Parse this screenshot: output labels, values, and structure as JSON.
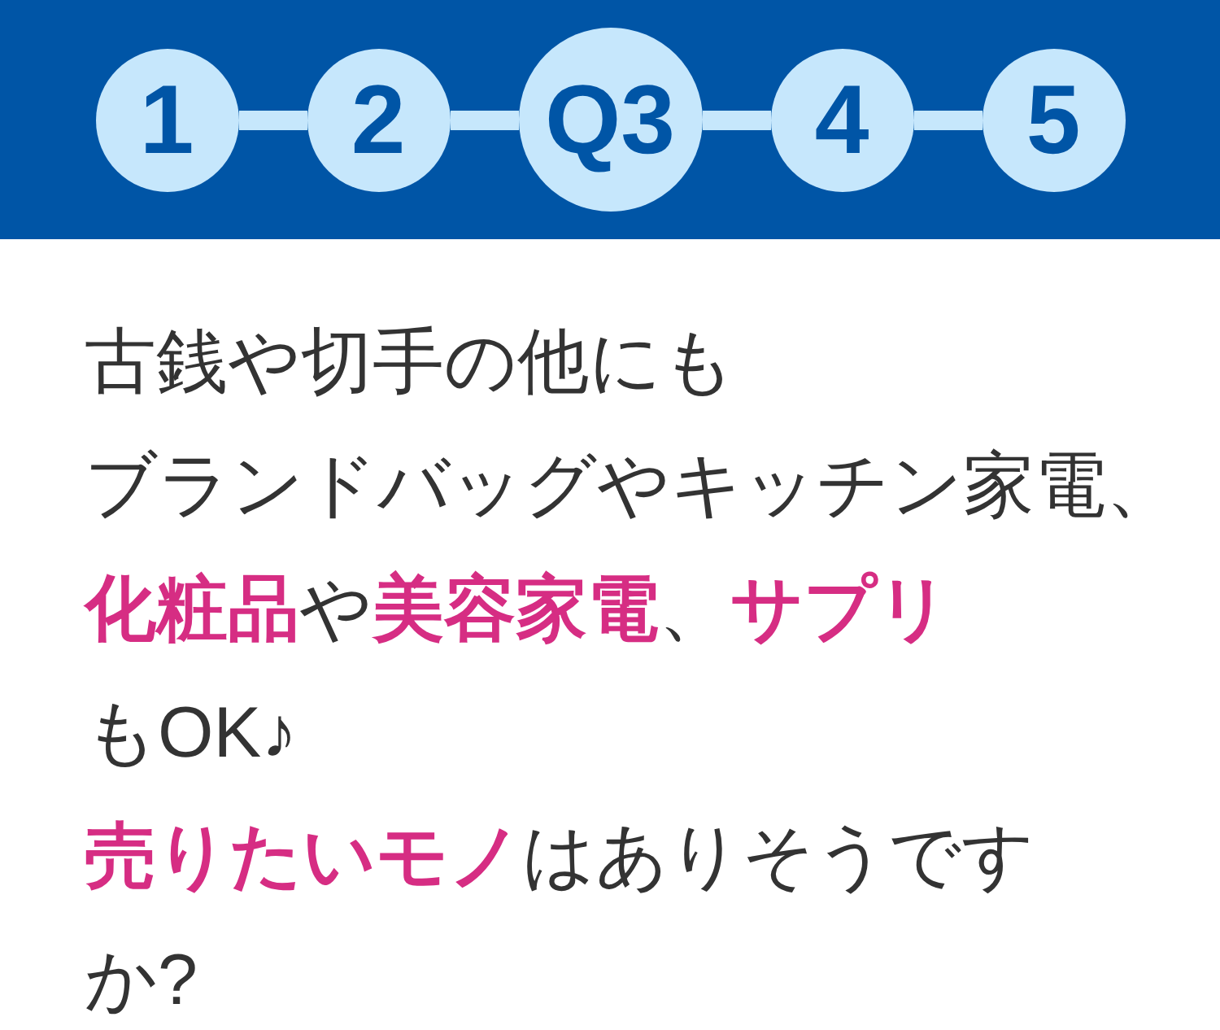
{
  "steps": [
    {
      "label": "1",
      "selected": false
    },
    {
      "label": "2",
      "selected": false
    },
    {
      "label": "Q3",
      "selected": true
    },
    {
      "label": "4",
      "selected": false
    },
    {
      "label": "5",
      "selected": false
    }
  ],
  "question": {
    "lines": [
      "古銭や切手の他にも",
      "ブランドバッグやキッチン家電、",
      "**化粧品**や**美容家電**、**サプリ**",
      "もOK♪",
      "**売りたいモノ**はありそうです",
      "か?"
    ]
  }
}
